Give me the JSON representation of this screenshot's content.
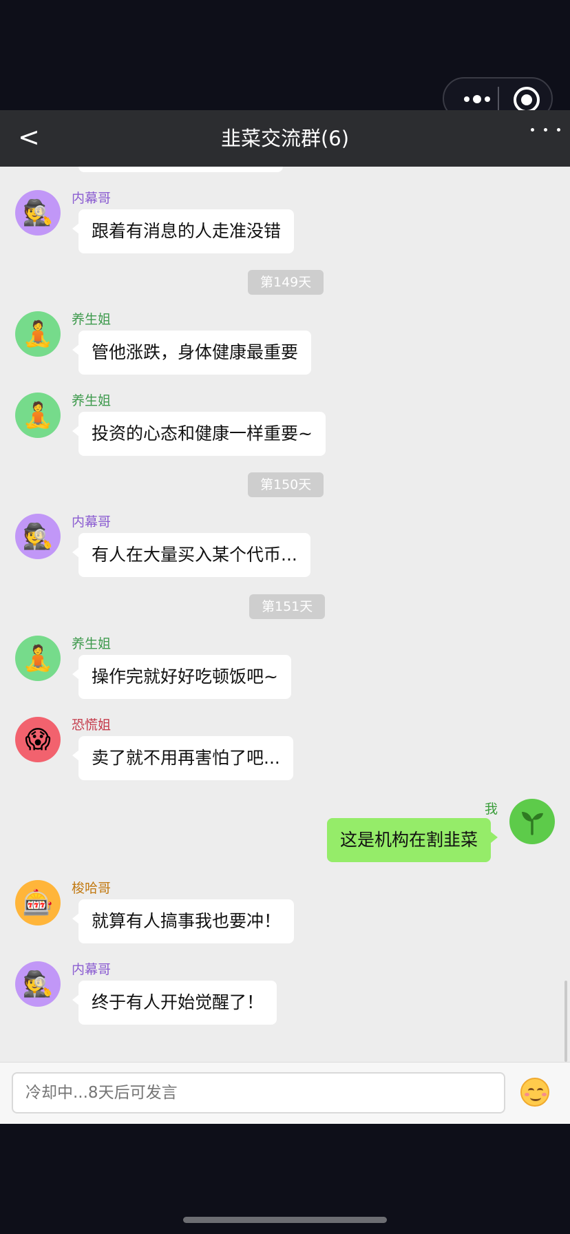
{
  "header": {
    "back": "<",
    "title": "韭菜交流群(6)"
  },
  "messages": [
    {
      "sender": "内幕哥",
      "text": "跟着有消息的人走准没错",
      "avatar": "🕵️",
      "color": "#8b5dd1",
      "avatar_bg": "#c197f7"
    },
    {
      "day": "第149天"
    },
    {
      "sender": "养生姐",
      "text": "管他涨跌，身体健康最重要",
      "avatar": "🧘",
      "color": "#3e9a4d",
      "avatar_bg": "#76db8b"
    },
    {
      "sender": "养生姐",
      "text": "投资的心态和健康一样重要~",
      "avatar": "🧘",
      "color": "#3e9a4d",
      "avatar_bg": "#76db8b"
    },
    {
      "day": "第150天"
    },
    {
      "sender": "内幕哥",
      "text": "有人在大量买入某个代币...",
      "avatar": "🕵️",
      "color": "#8b5dd1",
      "avatar_bg": "#c197f7"
    },
    {
      "day": "第151天"
    },
    {
      "sender": "养生姐",
      "text": "操作完就好好吃顿饭吧~",
      "avatar": "🧘",
      "color": "#3e9a4d",
      "avatar_bg": "#76db8b"
    },
    {
      "sender": "恐慌姐",
      "text": "卖了就不用再害怕了吧...",
      "avatar": "😱",
      "color": "#c43a4a",
      "avatar_bg": "#f2626e"
    },
    {
      "me": true,
      "sender": "我",
      "text": "这是机构在割韭菜"
    },
    {
      "sender": "梭哈哥",
      "text": "就算有人搞事我也要冲！",
      "avatar": "🎰",
      "color": "#c27a12",
      "avatar_bg": "#ffb53a"
    },
    {
      "sender": "内幕哥",
      "text": "终于有人开始觉醒了！",
      "avatar": "🕵️",
      "color": "#8b5dd1",
      "avatar_bg": "#c197f7"
    }
  ],
  "input": {
    "placeholder": "冷却中...8天后可发言"
  },
  "icons": {
    "emoji_button": "smiling-face-icon",
    "more": "more-dots-icon",
    "close": "close-target-icon"
  }
}
